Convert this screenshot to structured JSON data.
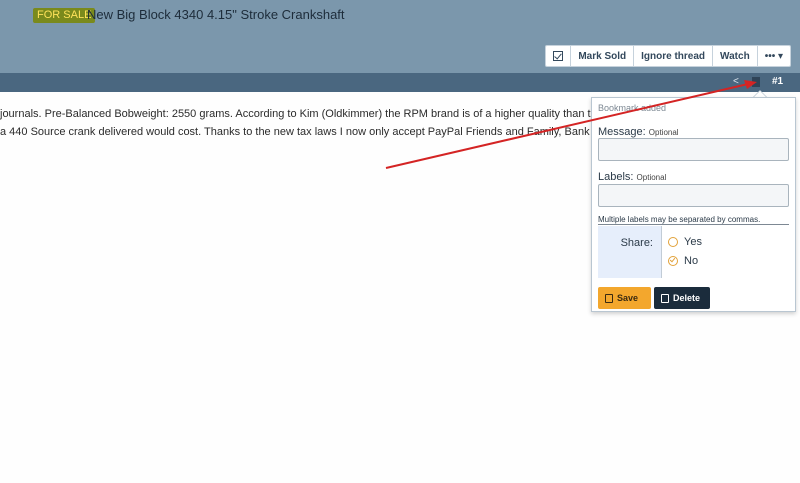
{
  "thread": {
    "prefix": "FOR SALE",
    "title": "New Big Block 4340 4.15\" Stroke Crankshaft"
  },
  "toolbar": {
    "mark_sold": "Mark Sold",
    "ignore_thread": "Ignore thread",
    "watch": "Watch",
    "more": "••• ▾"
  },
  "post": {
    "number": "#1",
    "line1": "journals. Pre-Balanced Bobweight: 2550 grams. According to Kim (Oldkimmer) the RPM brand is of a higher quality than the c",
    "line2": "a 440 Source crank delivered would cost. Thanks to the new tax laws I now only accept PayPal Friends and Family, Bank Check"
  },
  "bookmark_popup": {
    "header": "Bookmark added",
    "message_label": "Message:",
    "message_optional": "Optional",
    "message_value": "",
    "labels_label": "Labels:",
    "labels_optional": "Optional",
    "labels_value": "",
    "labels_hint": "Multiple labels may be separated by commas.",
    "share_label": "Share:",
    "share_yes": "Yes",
    "share_no": "No",
    "share_selected": "No",
    "save_label": "Save",
    "delete_label": "Delete"
  },
  "colors": {
    "header_bg": "#7b97ac",
    "post_bar": "#4a6780",
    "prefix_bg": "#7a8a1c",
    "save_button": "#f3a72d",
    "delete_button": "#1b2c3c",
    "annotation_arrow": "#d42424"
  }
}
